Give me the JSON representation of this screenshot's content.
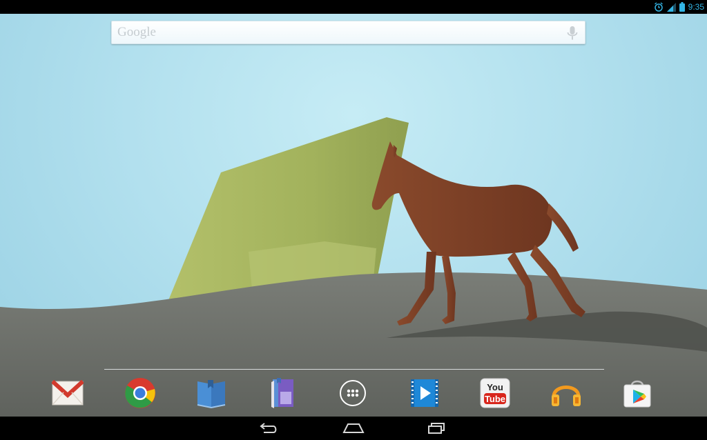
{
  "status_bar": {
    "time": "9:35",
    "icons": [
      "alarm-icon",
      "signal-icon",
      "battery-icon"
    ]
  },
  "search_widget": {
    "label": "Google",
    "icon": "mic-icon"
  },
  "wallpaper": {
    "type": "live-wallpaper",
    "colors": {
      "sky": "#b2e0ee",
      "ground": "#6f726c",
      "shape": "#a4b562",
      "horse": "#7a3f25"
    }
  },
  "dock": {
    "apps": [
      {
        "name": "Gmail",
        "icon": "gmail-icon"
      },
      {
        "name": "Chrome",
        "icon": "chrome-icon"
      },
      {
        "name": "Play Books",
        "icon": "play-books-icon"
      },
      {
        "name": "Play Magazines",
        "icon": "play-magazines-icon"
      },
      {
        "name": "Apps",
        "icon": "all-apps-icon"
      },
      {
        "name": "Play Movies",
        "icon": "play-movies-icon"
      },
      {
        "name": "YouTube",
        "icon": "youtube-icon",
        "text": "You Tube"
      },
      {
        "name": "Play Music",
        "icon": "play-music-icon"
      },
      {
        "name": "Play Store",
        "icon": "play-store-icon"
      }
    ]
  },
  "nav_bar": {
    "buttons": [
      "back-icon",
      "home-icon",
      "recents-icon"
    ]
  }
}
